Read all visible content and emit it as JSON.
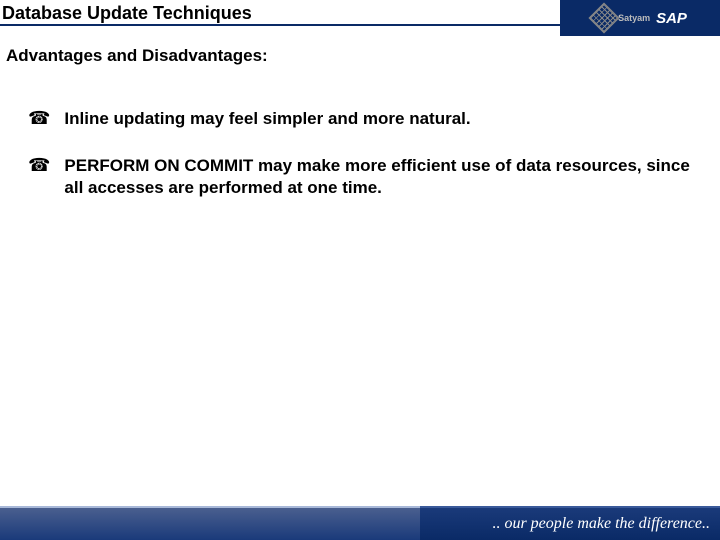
{
  "header": {
    "title": "Database Update Techniques",
    "logo_brand": "Satyam",
    "logo_sap": "SAP"
  },
  "subtitle": "Advantages and Disadvantages:",
  "bullets": [
    "Inline updating may feel simpler and more natural.",
    " PERFORM ON COMMIT may make more efficient use of data resources, since all accesses are performed at one time."
  ],
  "footer": {
    "tagline": ".. our people make the difference.."
  }
}
